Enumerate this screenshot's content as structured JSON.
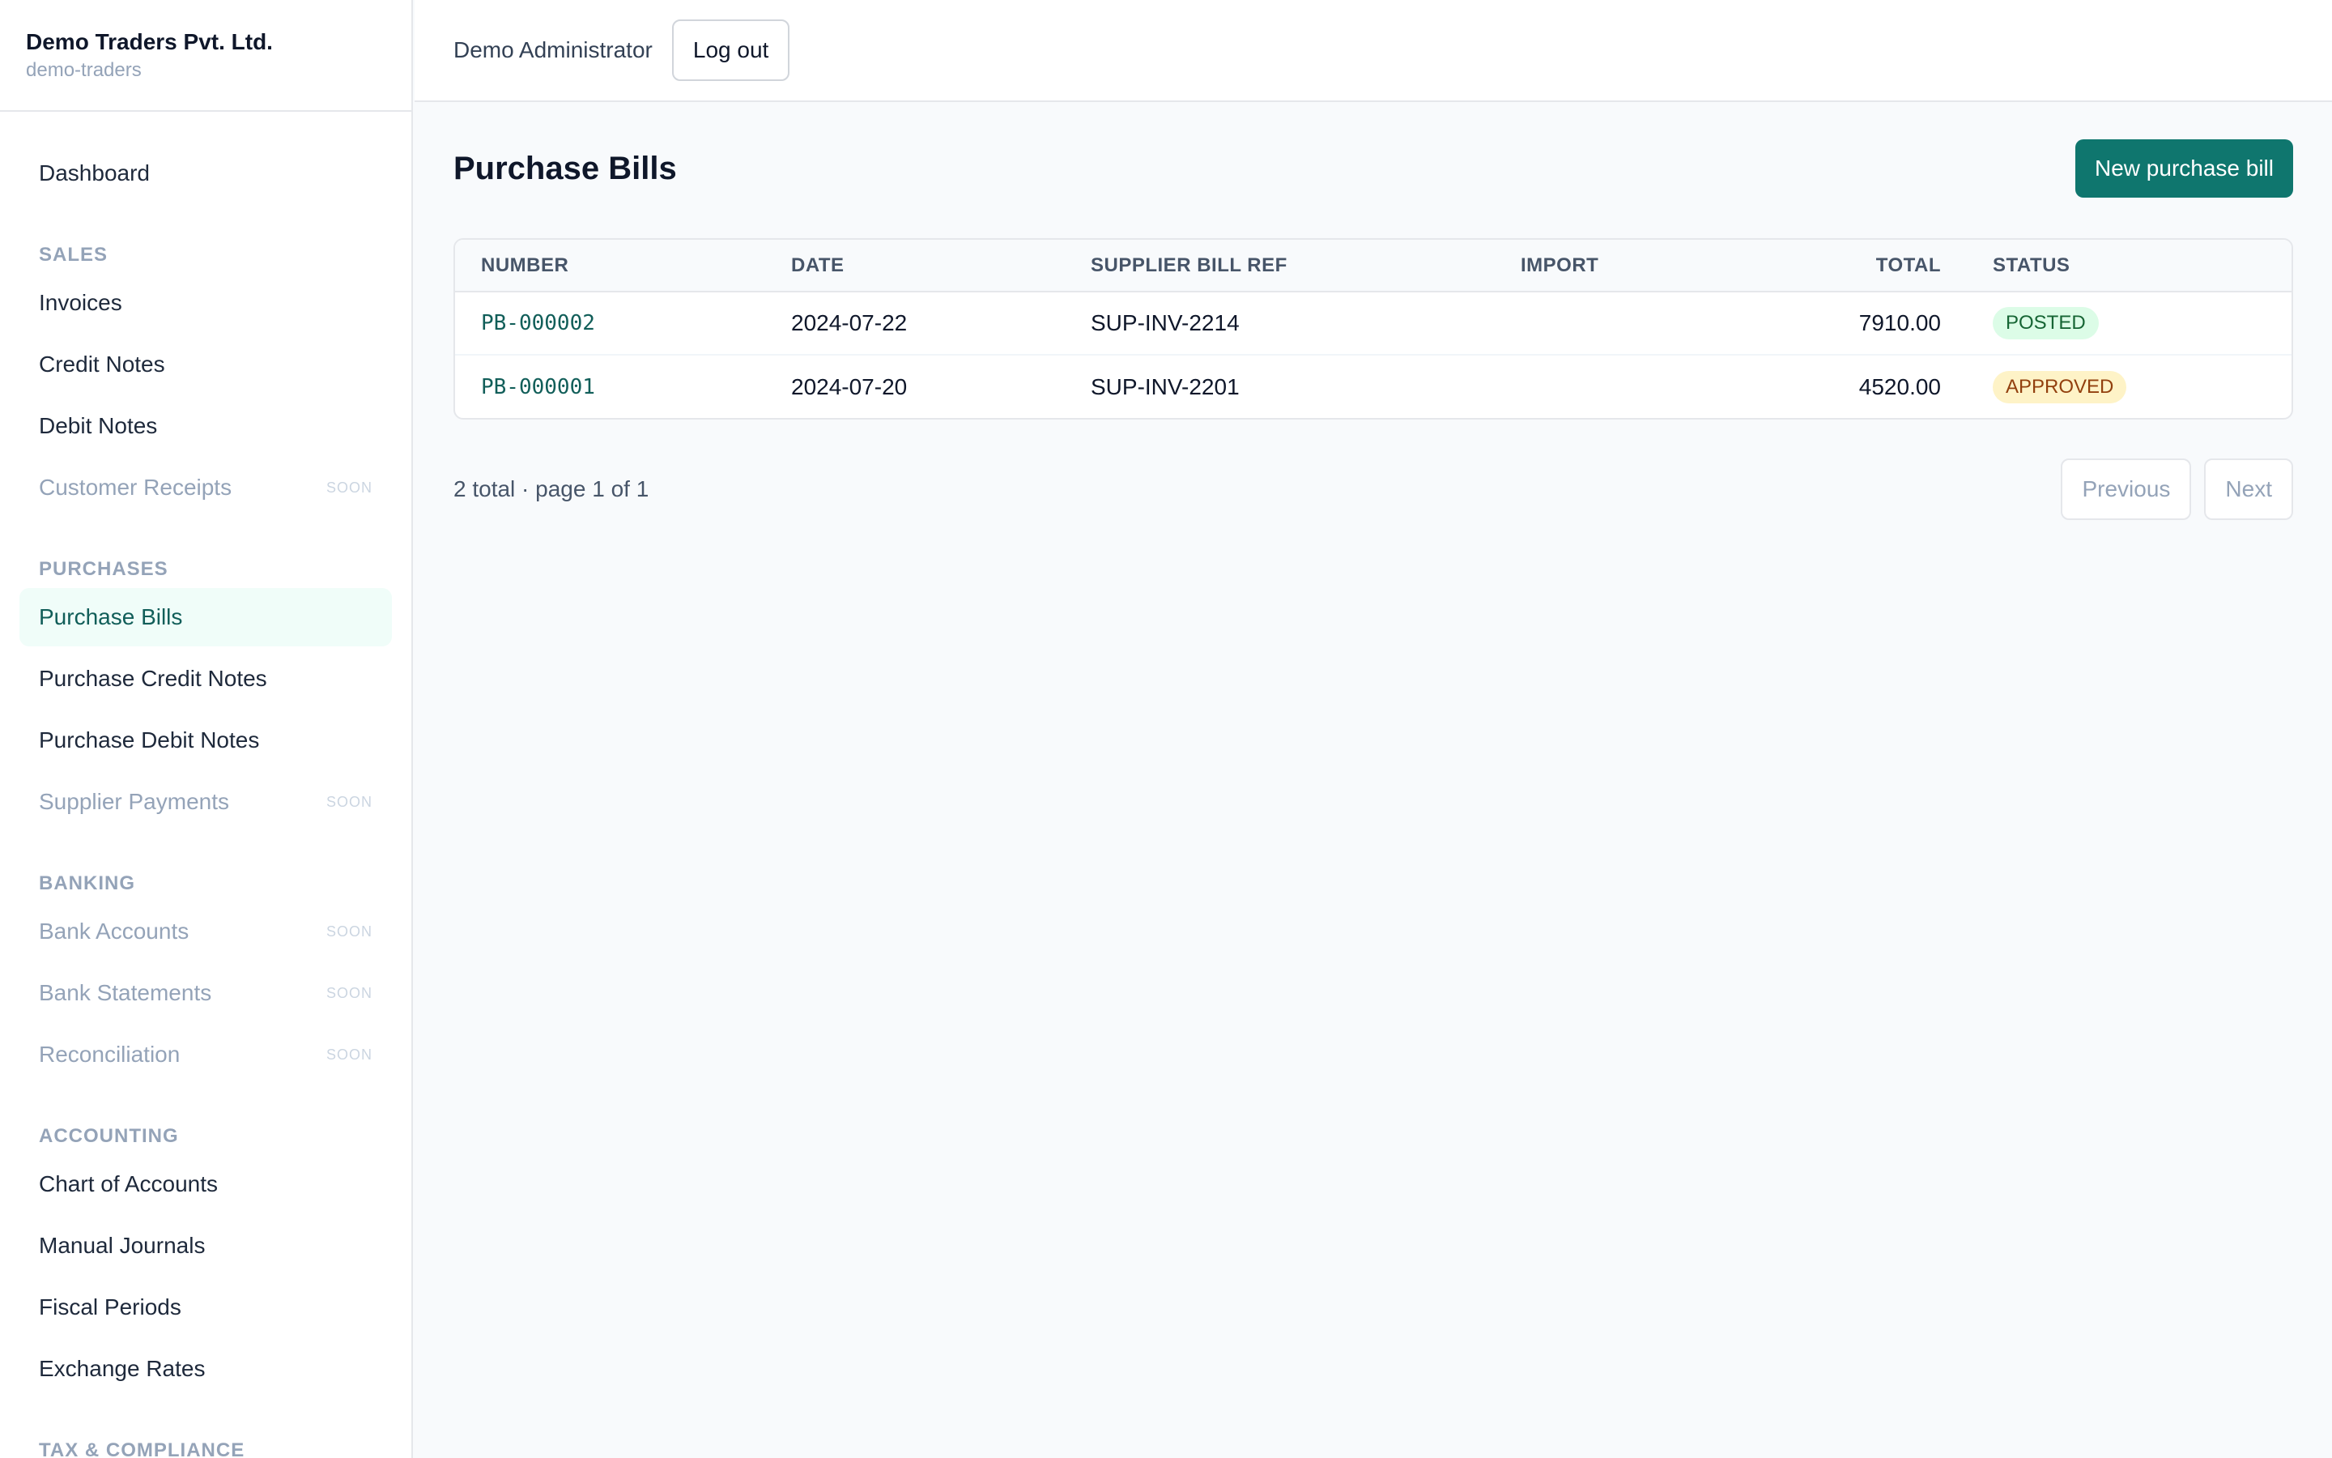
{
  "org": {
    "name": "Demo Traders Pvt. Ltd.",
    "slug": "demo-traders"
  },
  "topbar": {
    "user": "Demo Administrator",
    "logout_label": "Log out"
  },
  "sidebar": {
    "dashboard": "Dashboard",
    "soon_label": "SOON",
    "sections": {
      "sales": "SALES",
      "purchases": "PURCHASES",
      "banking": "BANKING",
      "accounting": "ACCOUNTING",
      "tax": "TAX & COMPLIANCE"
    },
    "sales": [
      "Invoices",
      "Credit Notes",
      "Debit Notes",
      "Customer Receipts"
    ],
    "purchases": [
      "Purchase Bills",
      "Purchase Credit Notes",
      "Purchase Debit Notes",
      "Supplier Payments"
    ],
    "banking": [
      "Bank Accounts",
      "Bank Statements",
      "Reconciliation"
    ],
    "accounting": [
      "Chart of Accounts",
      "Manual Journals",
      "Fiscal Periods",
      "Exchange Rates"
    ]
  },
  "main": {
    "title": "Purchase Bills",
    "new_label": "New purchase bill",
    "columns": [
      "NUMBER",
      "DATE",
      "SUPPLIER BILL REF",
      "IMPORT",
      "TOTAL",
      "STATUS"
    ],
    "rows": [
      {
        "number": "PB-000002",
        "date": "2024-07-22",
        "ref": "SUP-INV-2214",
        "import": "",
        "total": "7910.00",
        "status": "POSTED"
      },
      {
        "number": "PB-000001",
        "date": "2024-07-20",
        "ref": "SUP-INV-2201",
        "import": "",
        "total": "4520.00",
        "status": "APPROVED"
      }
    ],
    "pager": {
      "info": "2 total · page 1 of 1",
      "prev_label": "Previous",
      "next_label": "Next"
    }
  },
  "colors": {
    "accent": "#0f766e",
    "active_bg": "#f0fdf9",
    "posted_bg": "#dcfce7",
    "approved_bg": "#fef3c7"
  }
}
